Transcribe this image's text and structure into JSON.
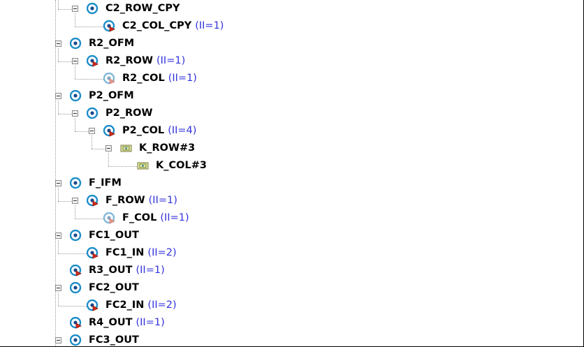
{
  "tree": {
    "items": [
      {
        "label": "C2_ROW_CPY",
        "ii": "",
        "icon": "loop-icon",
        "depth": 1,
        "toggle": true
      },
      {
        "label": "C2_COL_CPY",
        "ii": "(II=1)",
        "icon": "pipelined-loop-icon",
        "depth": 2,
        "toggle": false
      },
      {
        "label": "R2_OFM",
        "ii": "",
        "icon": "loop-icon",
        "depth": 0,
        "toggle": true
      },
      {
        "label": "R2_ROW",
        "ii": "(II=1)",
        "icon": "pipelined-loop-icon",
        "depth": 1,
        "toggle": true
      },
      {
        "label": "R2_COL",
        "ii": "(II=1)",
        "icon": "flattened-loop-icon",
        "depth": 2,
        "toggle": false
      },
      {
        "label": "P2_OFM",
        "ii": "",
        "icon": "loop-icon",
        "depth": 0,
        "toggle": true
      },
      {
        "label": "P2_ROW",
        "ii": "",
        "icon": "loop-icon",
        "depth": 1,
        "toggle": true
      },
      {
        "label": "P2_COL",
        "ii": "(II=4)",
        "icon": "pipelined-loop-icon",
        "depth": 2,
        "toggle": true
      },
      {
        "label": "K_ROW#3",
        "ii": "",
        "icon": "unrolled-loop-icon",
        "depth": 3,
        "toggle": true
      },
      {
        "label": "K_COL#3",
        "ii": "",
        "icon": "unrolled-loop-icon",
        "depth": 4,
        "toggle": false
      },
      {
        "label": "F_IFM",
        "ii": "",
        "icon": "loop-icon",
        "depth": 0,
        "toggle": true
      },
      {
        "label": "F_ROW",
        "ii": "(II=1)",
        "icon": "pipelined-loop-icon",
        "depth": 1,
        "toggle": true
      },
      {
        "label": "F_COL",
        "ii": "(II=1)",
        "icon": "flattened-loop-icon",
        "depth": 2,
        "toggle": false
      },
      {
        "label": "FC1_OUT",
        "ii": "",
        "icon": "loop-icon",
        "depth": 0,
        "toggle": true
      },
      {
        "label": "FC1_IN",
        "ii": "(II=2)",
        "icon": "pipelined-loop-icon",
        "depth": 1,
        "toggle": false
      },
      {
        "label": "R3_OUT",
        "ii": "(II=1)",
        "icon": "pipelined-loop-icon",
        "depth": 0,
        "toggle": false
      },
      {
        "label": "FC2_OUT",
        "ii": "",
        "icon": "loop-icon",
        "depth": 0,
        "toggle": true
      },
      {
        "label": "FC2_IN",
        "ii": "(II=2)",
        "icon": "pipelined-loop-icon",
        "depth": 1,
        "toggle": false
      },
      {
        "label": "R4_OUT",
        "ii": "(II=1)",
        "icon": "pipelined-loop-icon",
        "depth": 0,
        "toggle": false
      },
      {
        "label": "FC3_OUT",
        "ii": "",
        "icon": "loop-icon",
        "depth": 0,
        "toggle": true
      }
    ]
  }
}
